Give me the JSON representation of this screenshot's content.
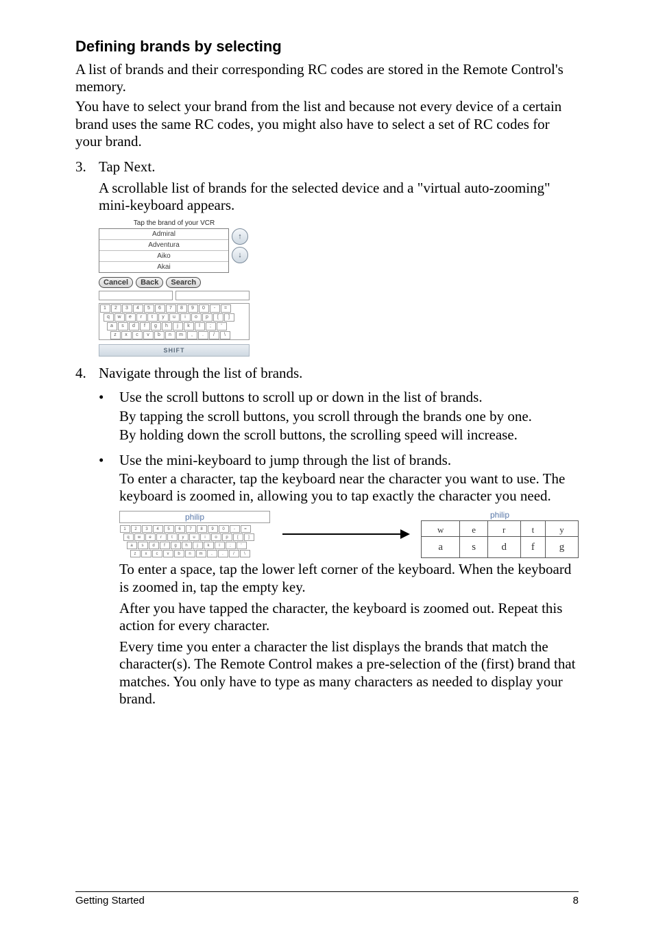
{
  "section": {
    "title": "Defining brands by selecting",
    "intro_p1": "A list of brands and their corresponding RC codes are stored in the Remote Control's memory.",
    "intro_p2": "You have to select your brand from the list and because not every device of a certain brand uses the same RC codes, you might also have to select a set of RC codes for your brand."
  },
  "steps": {
    "s3": {
      "num": "3.",
      "text": "Tap Next.",
      "desc": "A scrollable list of brands for the selected device and a \"virtual auto-zooming\" mini-keyboard appears."
    },
    "s4": {
      "num": "4.",
      "text": "Navigate through the list of brands."
    }
  },
  "device": {
    "header": "Tap the brand of your VCR",
    "brands": [
      "Admiral",
      "Adventura",
      "Aiko",
      "Akai"
    ],
    "buttons": {
      "cancel": "Cancel",
      "back": "Back",
      "search": "Search"
    },
    "keyboard": {
      "r1": [
        "1",
        "2",
        "3",
        "4",
        "5",
        "6",
        "7",
        "8",
        "9",
        "0",
        "-",
        "="
      ],
      "r2": [
        "q",
        "w",
        "e",
        "r",
        "t",
        "y",
        "u",
        "i",
        "o",
        "p",
        "[",
        "]"
      ],
      "r3": [
        "a",
        "s",
        "d",
        "f",
        "g",
        "h",
        "j",
        "k",
        "l",
        ";",
        "'"
      ],
      "r4": [
        "z",
        "x",
        "c",
        "v",
        "b",
        "n",
        "m",
        ",",
        ".",
        "/",
        "\\"
      ]
    },
    "shift": "SHIFT",
    "arrows": {
      "up": "↑",
      "down": "↓"
    }
  },
  "bullets": {
    "b1": {
      "l1": "Use the scroll buttons to scroll up or down in the list of brands.",
      "l2": "By tapping the scroll buttons, you scroll through the brands one by one.",
      "l3": "By holding down the scroll buttons, the scrolling speed will increase."
    },
    "b2": {
      "l1": "Use the mini-keyboard to jump through the list of brands.",
      "l2": "To enter a character, tap the keyboard near the character you want to use. The keyboard is zoomed in, allowing you to tap exactly the character you need."
    }
  },
  "zoom": {
    "small_label": "philip",
    "big_label": "philip",
    "big_r1": [
      "w",
      "e",
      "r",
      "t",
      "y"
    ],
    "big_r2": [
      "a",
      "s",
      "d",
      "f",
      "g"
    ]
  },
  "tail": {
    "p1": "To enter a space, tap the lower left corner of the keyboard. When the keyboard is zoomed in, tap the empty key.",
    "p2": "After you have tapped the character, the keyboard is zoomed out. Repeat this action for every character.",
    "p3": "Every time you enter a character the list displays the brands that match the character(s). The Remote Control makes a pre-selection of the (first) brand that matches. You only have to type as many characters as needed to display your brand."
  },
  "footer": {
    "left": "Getting Started",
    "right": "8"
  }
}
